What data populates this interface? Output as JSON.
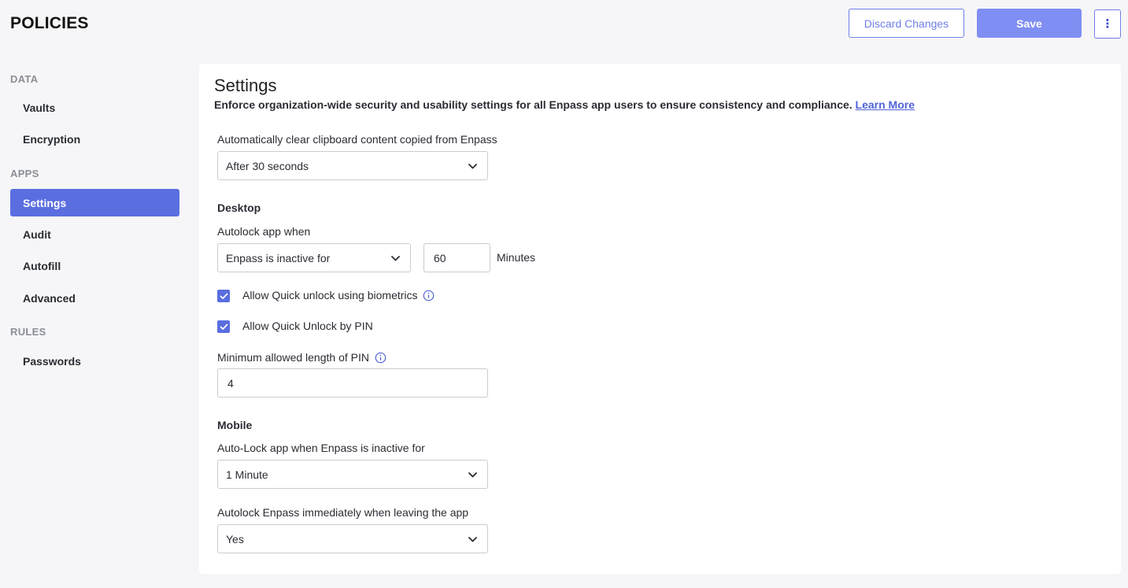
{
  "header": {
    "title": "POLICIES",
    "discard_label": "Discard Changes",
    "save_label": "Save",
    "more_label": "⋮"
  },
  "sidebar": {
    "sections": [
      {
        "label": "DATA",
        "items": [
          {
            "label": "Vaults"
          },
          {
            "label": "Encryption"
          }
        ]
      },
      {
        "label": "APPS",
        "items": [
          {
            "label": "Settings",
            "active": true
          },
          {
            "label": "Audit"
          },
          {
            "label": "Autofill"
          },
          {
            "label": "Advanced"
          }
        ]
      },
      {
        "label": "RULES",
        "items": [
          {
            "label": "Passwords"
          }
        ]
      }
    ]
  },
  "main": {
    "title": "Settings",
    "subtitle": "Enforce organization-wide security and usability settings for all Enpass app users to ensure consistency and compliance.",
    "learn_more": "Learn More",
    "clipboard": {
      "label": "Automatically clear clipboard content copied from Enpass",
      "value": "After 30 seconds"
    },
    "desktop": {
      "heading": "Desktop",
      "autolock_label": "Autolock app when",
      "autolock_value": "Enpass is inactive for",
      "minutes_value": "60",
      "minutes_unit": "Minutes",
      "biometrics_label": "Allow Quick unlock using biometrics",
      "biometrics_checked": true,
      "pin_label": "Allow Quick Unlock by PIN",
      "pin_checked": true,
      "min_pin_label": "Minimum allowed length of PIN",
      "min_pin_value": "4"
    },
    "mobile": {
      "heading": "Mobile",
      "autolock_label": "Auto-Lock app when Enpass is inactive for",
      "autolock_value": "1 Minute",
      "leave_label": "Autolock Enpass immediately when leaving the app",
      "leave_value": "Yes"
    }
  },
  "colors": {
    "accent": "#5a6ee0",
    "save_button": "#7f8ef3",
    "link": "#4f63d8",
    "background": "#f6f6f8"
  },
  "icons": {
    "chevron": "chevron-down-icon",
    "info": "info-icon",
    "check": "check-icon",
    "more": "more-vertical-icon"
  }
}
